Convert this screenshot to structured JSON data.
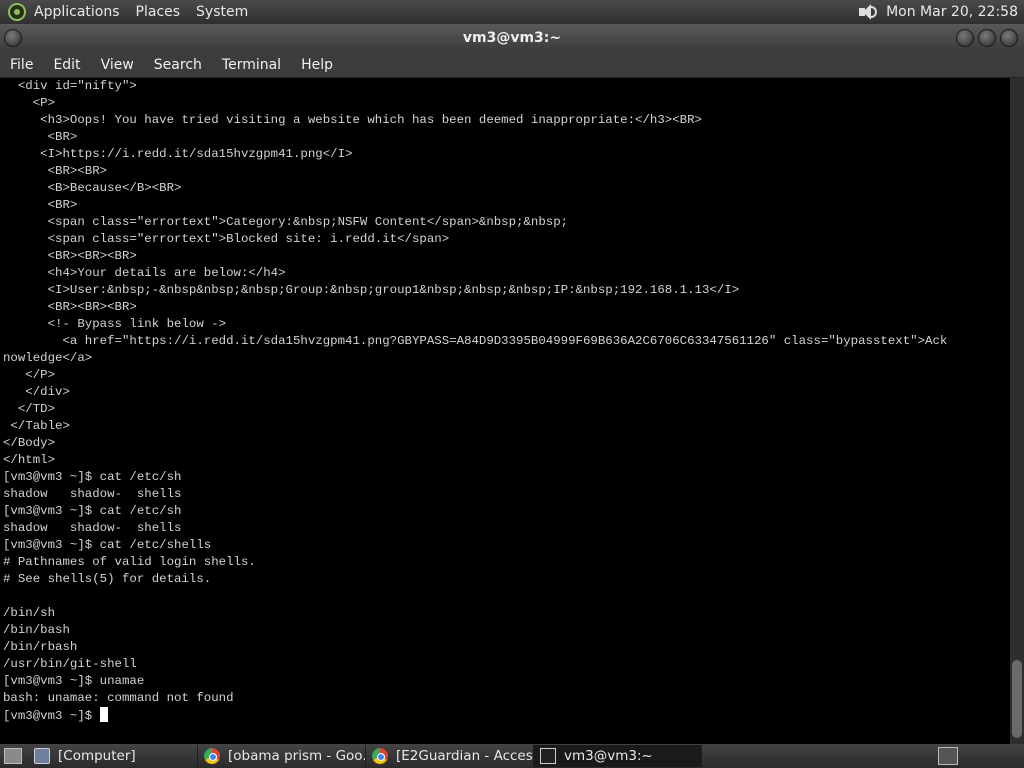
{
  "top_panel": {
    "menus": [
      "Applications",
      "Places",
      "System"
    ],
    "clock": "Mon Mar 20, 22:58",
    "icons": [
      "distro-logo-icon",
      "volume-icon"
    ]
  },
  "window": {
    "title": "vm3@vm3:~",
    "menu": [
      "File",
      "Edit",
      "View",
      "Search",
      "Terminal",
      "Help"
    ],
    "terminal_lines": [
      "  <div id=\"nifty\">",
      "    <P>",
      "     <h3>Oops! You have tried visiting a website which has been deemed inappropriate:</h3><BR>",
      "      <BR>",
      "     <I>https://i.redd.it/sda15hvzgpm41.png</I>",
      "      <BR><BR>",
      "      <B>Because</B><BR>",
      "      <BR>",
      "      <span class=\"errortext\">Category:&nbsp;NSFW Content</span>&nbsp;&nbsp;",
      "      <span class=\"errortext\">Blocked site: i.redd.it</span>",
      "      <BR><BR><BR>",
      "      <h4>Your details are below:</h4>",
      "      <I>User:&nbsp;-&nbsp&nbsp;&nbsp;Group:&nbsp;group1&nbsp;&nbsp;&nbsp;IP:&nbsp;192.168.1.13</I>",
      "      <BR><BR><BR>",
      "      <!- Bypass link below ->",
      "        <a href=\"https://i.redd.it/sda15hvzgpm41.png?GBYPASS=A84D9D3395B04999F69B636A2C6706C63347561126\" class=\"bypasstext\">Ack",
      "nowledge</a>",
      "   </P>",
      "   </div>",
      "  </TD>",
      " </Table>",
      "</Body>",
      "</html>",
      "[vm3@vm3 ~]$ cat /etc/sh",
      "shadow   shadow-  shells",
      "[vm3@vm3 ~]$ cat /etc/sh",
      "shadow   shadow-  shells",
      "[vm3@vm3 ~]$ cat /etc/shells",
      "# Pathnames of valid login shells.",
      "# See shells(5) for details.",
      "",
      "/bin/sh",
      "/bin/bash",
      "/bin/rbash",
      "/usr/bin/git-shell",
      "[vm3@vm3 ~]$ unamae",
      "bash: unamae: command not found"
    ],
    "prompt": "[vm3@vm3 ~]$"
  },
  "taskbar": {
    "tasks": [
      {
        "label": "[Computer]",
        "icon": "computer-icon"
      },
      {
        "label": "[obama prism - Goo...",
        "icon": "chrome-icon"
      },
      {
        "label": "[E2Guardian - Acces...",
        "icon": "chrome-icon"
      },
      {
        "label": "vm3@vm3:~",
        "icon": "terminal-icon"
      }
    ]
  },
  "colors": {
    "terminal_bg": "#000000",
    "terminal_fg": "#d3d3d3",
    "panel_bg": "#3a3a3a"
  }
}
